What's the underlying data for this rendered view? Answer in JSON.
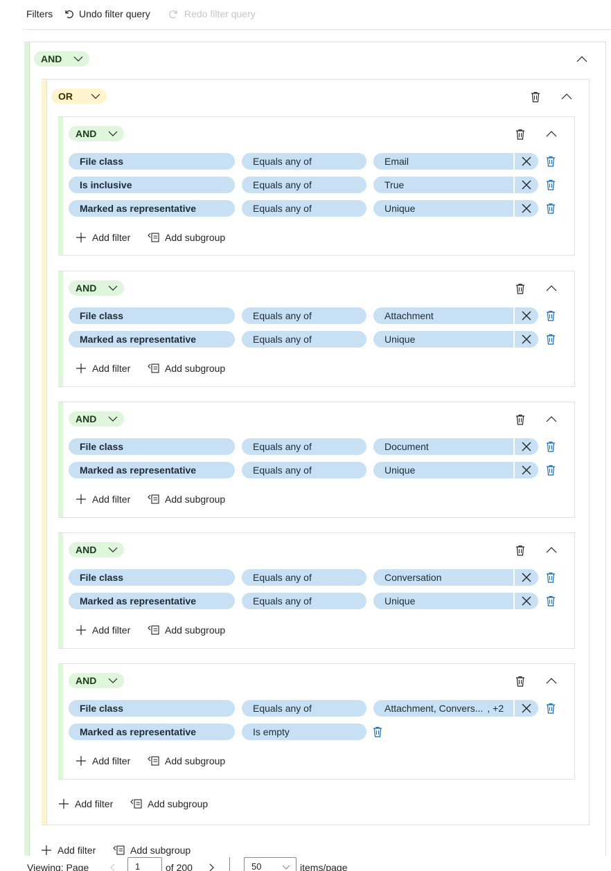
{
  "toolbar": {
    "filters_label": "Filters",
    "undo_label": "Undo filter query",
    "redo_label": "Redo filter query"
  },
  "root": {
    "operator": "AND",
    "or_group": {
      "operator": "OR",
      "subgroups": [
        {
          "operator": "AND",
          "rows": [
            {
              "field": "File class",
              "condition": "Equals any of",
              "value": "Email"
            },
            {
              "field": "Is inclusive",
              "condition": "Equals any of",
              "value": "True"
            },
            {
              "field": "Marked as representative",
              "condition": "Equals any of",
              "value": "Unique"
            }
          ]
        },
        {
          "operator": "AND",
          "rows": [
            {
              "field": "File class",
              "condition": "Equals any of",
              "value": "Attachment"
            },
            {
              "field": "Marked as representative",
              "condition": "Equals any of",
              "value": "Unique"
            }
          ]
        },
        {
          "operator": "AND",
          "rows": [
            {
              "field": "File class",
              "condition": "Equals any of",
              "value": "Document"
            },
            {
              "field": "Marked as representative",
              "condition": "Equals any of",
              "value": "Unique"
            }
          ]
        },
        {
          "operator": "AND",
          "rows": [
            {
              "field": "File class",
              "condition": "Equals any of",
              "value": "Conversation"
            },
            {
              "field": "Marked as representative",
              "condition": "Equals any of",
              "value": "Unique"
            }
          ]
        },
        {
          "operator": "AND",
          "rows": [
            {
              "field": "File class",
              "condition": "Equals any of",
              "value": "Attachment, Convers...",
              "more": ", +2"
            },
            {
              "field": "Marked as representative",
              "condition": "Is empty"
            }
          ]
        }
      ]
    }
  },
  "actions": {
    "add_filter": "Add filter",
    "add_subgroup": "Add subgroup"
  },
  "pager": {
    "viewing_label": "Viewing: Page",
    "page": "1",
    "of_label": "of 200",
    "page_size": "50",
    "items_label": "items/page"
  },
  "colors": {
    "and_bar": "#dff6dd",
    "or_bar": "#fff4ce",
    "chip": "#c7e0f4",
    "delete_icon": "#0f6cbd"
  }
}
